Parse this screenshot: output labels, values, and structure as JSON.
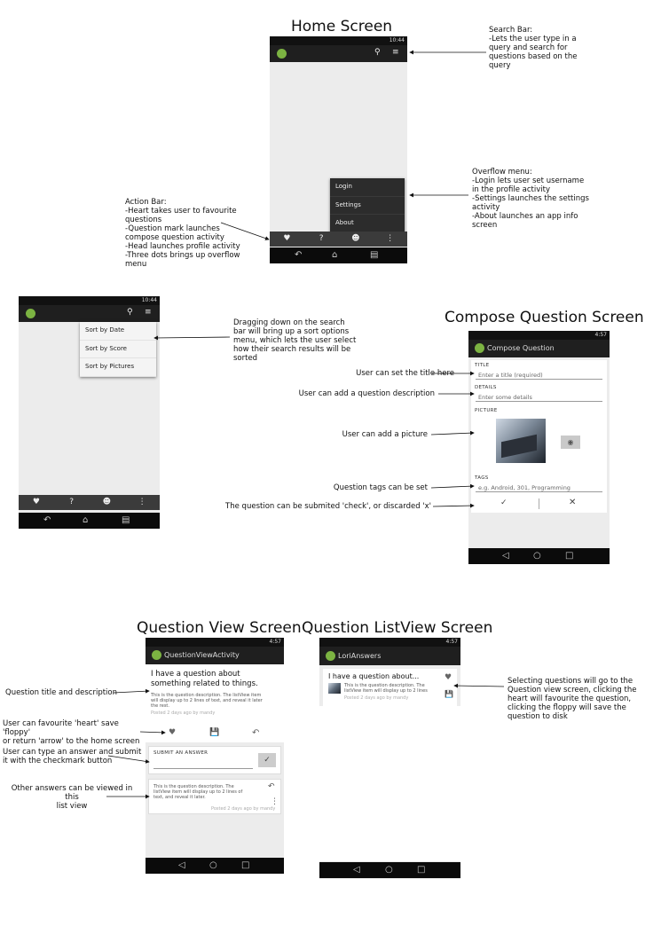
{
  "screen_titles": {
    "home": "Home Screen",
    "compose": "Compose Question Screen",
    "question_view": "Question View Screen",
    "list_view": "Question ListView Screen"
  },
  "home_screen": {
    "status_time": "10:44",
    "overflow_menu": [
      "Login",
      "Settings",
      "About"
    ],
    "notes": {
      "search_bar": "Search Bar:\n-Lets the user type in a\nquery and search for\nquestions based on the\nquery",
      "overflow_menu": "Overflow menu:\n-Login lets user set username\nin the profile activity\n-Settings launches the settings\nactivity\n-About launches an app info\nscreen",
      "action_bar": "Action Bar:\n-Heart takes user to favourite\nquestions\n-Question mark launches\ncompose question activity\n-Head launches profile activity\n-Three dots brings up overflow\nmenu"
    }
  },
  "sort_screen": {
    "status_time": "10:44",
    "sort_menu": [
      "Sort by Date",
      "Sort by Score",
      "Sort by Pictures"
    ],
    "note": "Dragging down on the search\nbar will bring up a sort options\nmenu, which lets the user select\nhow their search results will be\nsorted"
  },
  "compose_screen": {
    "status_time": "4:57",
    "app_title": "Compose Question",
    "fields": {
      "title_label": "TITLE",
      "title_hint": "Enter a title (required)",
      "details_label": "DETAILS",
      "details_hint": "Enter some details",
      "picture_label": "PICTURE",
      "tags_label": "TAGS",
      "tags_hint": "e.g. Android, 301, Programming"
    },
    "notes": {
      "title": "User can set the title here",
      "description": "User can add a question description",
      "picture": "User can add a picture",
      "tags": "Question tags can be set",
      "submit": "The question can be submited 'check', or discarded 'x'"
    }
  },
  "question_view_screen": {
    "status_time": "4:57",
    "app_title": "QuestionViewActivity",
    "question_title": "I have a question about\nsomething related to things.",
    "question_body": "This is the question description. The listView item\nwill display up to 2 lines of text, and reveal it later\nthe rest.",
    "question_meta": "Posted 2 days ago by mandy",
    "answer_label": "SUBMIT AN ANSWER",
    "answer_body": "This is the question description. The\nlistView item will display up to 2 lines of\ntext, and reveal it later.",
    "answer_meta": "Posted 2 days ago by mandy",
    "notes": {
      "title_desc": "Question title and description",
      "actions": "User can favourite 'heart' save 'floppy'\nor return 'arrow' to the home screen",
      "answer": "User can type an answer and submit\nit with the checkmark button",
      "other_answers": "Other answers can be viewed in this\nlist view"
    }
  },
  "list_view_screen": {
    "status_time": "4:57",
    "app_title": "LoriAnswers",
    "item_title": "I have a question about...",
    "item_body": "This is the question description. The\nlistView item will display up to 2 lines",
    "item_meta": "Posted 2 days ago by mandy",
    "note": "Selecting questions will go to the\nQuestion view screen, clicking the\nheart will favourite the question,\nclicking the floppy will save the\nquestion to disk"
  },
  "colors": {
    "appbar": "#1f1f1f",
    "bottom_bar": "#3b3b3b",
    "nav_bar": "#0b0b0b",
    "screen_bg": "#ececec",
    "app_logo": "#7cb342"
  }
}
